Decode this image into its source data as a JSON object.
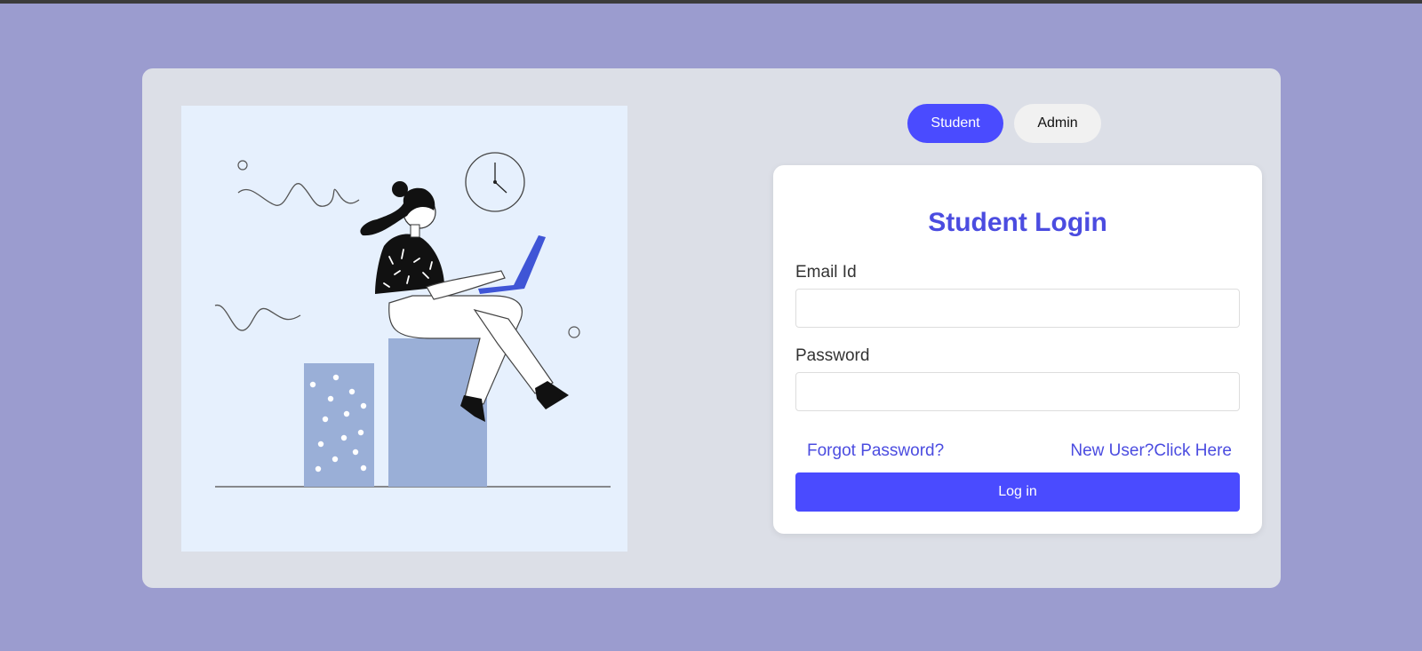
{
  "role_toggle": {
    "student_label": "Student",
    "admin_label": "Admin",
    "active": "Student"
  },
  "login": {
    "title": "Student Login",
    "email_label": "Email Id",
    "email_value": "",
    "password_label": "Password",
    "password_value": "",
    "forgot_password": "Forgot Password?",
    "new_user": "New User?Click Here",
    "submit_label": "Log in"
  },
  "colors": {
    "page_background": "#9b9ccf",
    "card_background": "#dcdfe7",
    "accent": "#4a4bff",
    "title": "#4b4ce0",
    "illustration_background": "#e6f0fd",
    "illustration_blocks": "#9aafd7"
  },
  "illustration": {
    "icon": "woman-with-laptop-illustration"
  }
}
